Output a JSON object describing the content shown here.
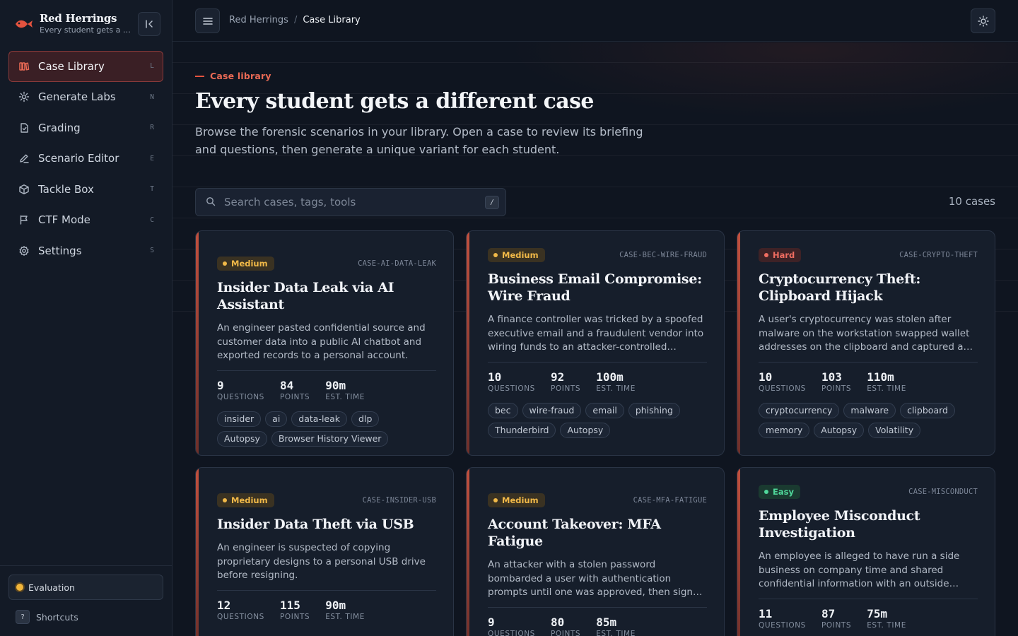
{
  "brand": {
    "name": "Red Herrings",
    "tagline": "Every student gets a different case",
    "accent": "#e4533f"
  },
  "sidebar": {
    "items": [
      {
        "label": "Case Library",
        "key": "L",
        "icon": "library-icon",
        "active": true
      },
      {
        "label": "Generate Labs",
        "key": "N",
        "icon": "sparkle-icon",
        "active": false
      },
      {
        "label": "Grading",
        "key": "R",
        "icon": "clipboard-check-icon",
        "active": false
      },
      {
        "label": "Scenario Editor",
        "key": "E",
        "icon": "pen-icon",
        "active": false
      },
      {
        "label": "Tackle Box",
        "key": "T",
        "icon": "box-icon",
        "active": false
      },
      {
        "label": "CTF Mode",
        "key": "C",
        "icon": "flag-icon",
        "active": false
      },
      {
        "label": "Settings",
        "key": "S",
        "icon": "gear-icon",
        "active": false
      }
    ],
    "evaluation_label": "Evaluation",
    "shortcuts_key": "?",
    "shortcuts_label": "Shortcuts"
  },
  "topbar": {
    "breadcrumb_root": "Red Herrings",
    "breadcrumb_sep": "/",
    "breadcrumb_current": "Case Library"
  },
  "main": {
    "eyebrow": "Case library",
    "title": "Every student gets a different case",
    "description": "Browse the forensic scenarios in your library. Open a case to review its briefing and questions, then generate a unique variant for each student.",
    "search_placeholder": "Search cases, tags, tools",
    "search_value": "",
    "search_kbd": "/",
    "case_count": "10 cases"
  },
  "cards": [
    {
      "difficulty": "Medium",
      "level": "medium",
      "id": "CASE-AI-DATA-LEAK",
      "title": "Insider Data Leak via AI Assistant",
      "description": "An engineer pasted confidential source and customer data into a public AI chatbot and exported records to a personal account.",
      "questions": "9",
      "points": "84",
      "time": "90m",
      "tags": [
        "insider",
        "ai",
        "data-leak",
        "dlp",
        "Autopsy",
        "Browser History Viewer"
      ]
    },
    {
      "difficulty": "Medium",
      "level": "medium",
      "id": "CASE-BEC-WIRE-FRAUD",
      "title": "Business Email Compromise: Wire Fraud",
      "description": "A finance controller was tricked by a spoofed executive email and a fraudulent vendor into wiring funds to an attacker-controlled account.",
      "questions": "10",
      "points": "92",
      "time": "100m",
      "tags": [
        "bec",
        "wire-fraud",
        "email",
        "phishing",
        "Thunderbird",
        "Autopsy"
      ]
    },
    {
      "difficulty": "Hard",
      "level": "hard",
      "id": "CASE-CRYPTO-THEFT",
      "title": "Cryptocurrency Theft: Clipboard Hijack",
      "description": "A user's cryptocurrency was stolen after malware on the workstation swapped wallet addresses on the clipboard and captured a seed phrase.",
      "questions": "10",
      "points": "103",
      "time": "110m",
      "tags": [
        "cryptocurrency",
        "malware",
        "clipboard",
        "memory",
        "Autopsy",
        "Volatility"
      ]
    },
    {
      "difficulty": "Medium",
      "level": "medium",
      "id": "CASE-INSIDER-USB",
      "title": "Insider Data Theft via USB",
      "description": "An engineer is suspected of copying proprietary designs to a personal USB drive before resigning.",
      "questions": "12",
      "points": "115",
      "time": "90m",
      "tags": []
    },
    {
      "difficulty": "Medium",
      "level": "medium",
      "id": "CASE-MFA-FATIGUE",
      "title": "Account Takeover: MFA Fatigue",
      "description": "An attacker with a stolen password bombarded a user with authentication prompts until one was approved, then signed in from a foreign location.",
      "questions": "9",
      "points": "80",
      "time": "85m",
      "tags": []
    },
    {
      "difficulty": "Easy",
      "level": "easy",
      "id": "CASE-MISCONDUCT",
      "title": "Employee Misconduct Investigation",
      "description": "An employee is alleged to have run a side business on company time and shared confidential information with an outside party.",
      "questions": "11",
      "points": "87",
      "time": "75m",
      "tags": []
    }
  ],
  "stat_labels": {
    "questions": "QUESTIONS",
    "points": "POINTS",
    "time": "EST. TIME"
  },
  "colors": {
    "background": "#0f1520",
    "card": "#161e2b",
    "medium": "#f1b948",
    "hard": "#f06d61",
    "easy": "#4fd79a"
  }
}
